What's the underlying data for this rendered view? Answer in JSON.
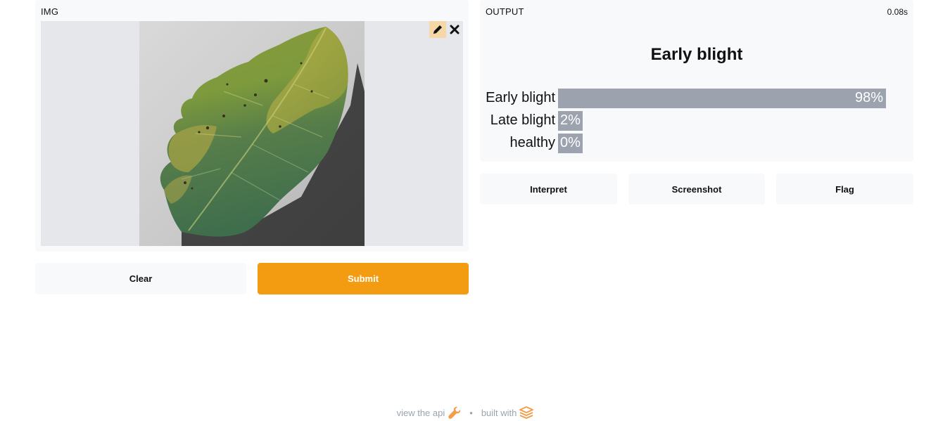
{
  "input": {
    "label": "IMG",
    "image_alt": "tomato leaf with early blight",
    "icons": {
      "edit": "pencil-icon",
      "remove": "close-icon"
    }
  },
  "buttons": {
    "clear": "Clear",
    "submit": "Submit"
  },
  "output": {
    "label": "OUTPUT",
    "timer": "0.08s",
    "predicted": "Early blight",
    "confidences": [
      {
        "label": "Early blight",
        "pct_text": "98%",
        "value": 0.98
      },
      {
        "label": "Late blight",
        "pct_text": "2%",
        "value": 0.02
      },
      {
        "label": "healthy",
        "pct_text": "0%",
        "value": 0.0
      }
    ]
  },
  "actions": {
    "interpret": "Interpret",
    "screenshot": "Screenshot",
    "flag": "Flag"
  },
  "footer": {
    "api": "view the api",
    "separator": "•",
    "built": "built with",
    "api_icon": "wrench-icon",
    "built_icon": "gradio-logo-icon"
  },
  "colors": {
    "accent": "#f39c12",
    "bar": "#9ca3af",
    "panel": "#f8f9fb",
    "image_bg": "#e5e7eb"
  }
}
